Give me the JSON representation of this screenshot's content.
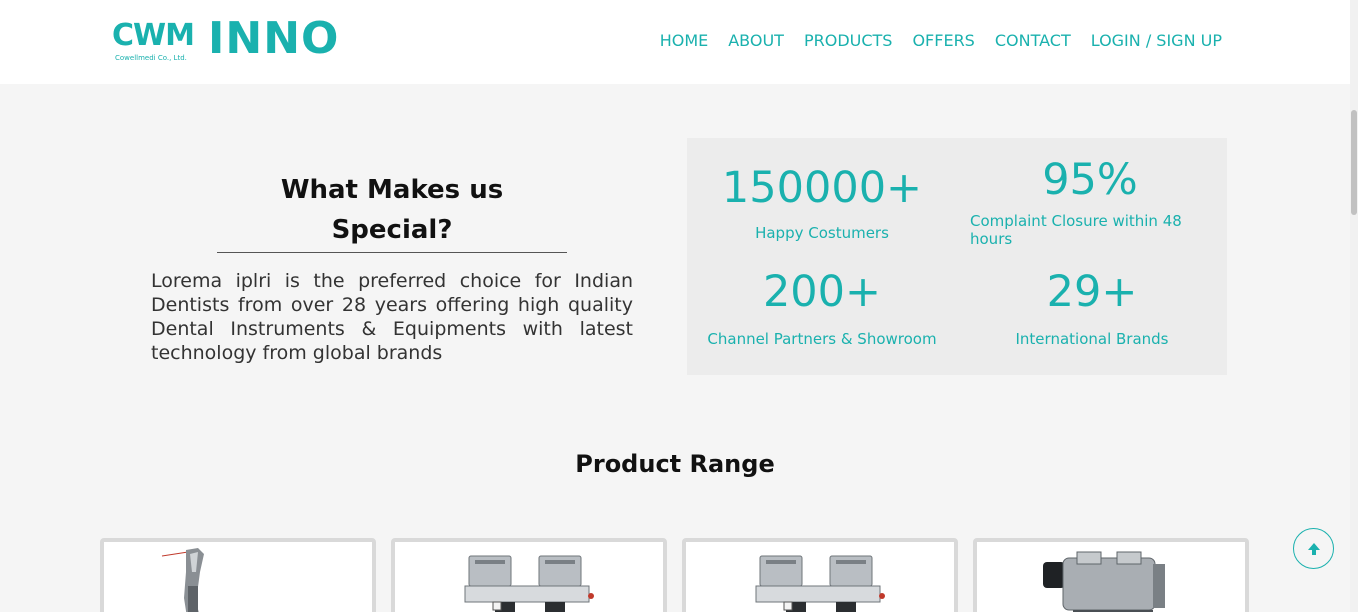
{
  "brand": {
    "logo_left": "CWM",
    "logo_sub": "Cowellmedi Co., Ltd.",
    "logo_right": "INNO",
    "accent_color": "#1ab1ae"
  },
  "nav": {
    "items": [
      {
        "label": "HOME"
      },
      {
        "label": "ABOUT"
      },
      {
        "label": "PRODUCTS"
      },
      {
        "label": "OFFERS"
      },
      {
        "label": "CONTACT"
      },
      {
        "label": "LOGIN / SIGN UP"
      }
    ]
  },
  "special": {
    "title": "What Makes us Special?",
    "text": "Lorema iplri is the preferred choice for Indian Dentists from over 28 years offering high quality Dental Instruments & Equipments with latest technology from global brands"
  },
  "stats": [
    {
      "value": "150000+",
      "label": "Happy Costumers"
    },
    {
      "value": "95%",
      "label": "Complaint Closure within 48 hours"
    },
    {
      "value": "200+",
      "label": "Channel Partners & Showroom"
    },
    {
      "value": "29+",
      "label": "International Brands"
    }
  ],
  "product_range": {
    "title": "Product Range",
    "cards": [
      {
        "image": "dental-handpiece"
      },
      {
        "image": "air-compressor"
      },
      {
        "image": "air-compressor"
      },
      {
        "image": "compressor-motor"
      }
    ]
  },
  "icons": {
    "scroll_top": "arrow-up-icon"
  }
}
